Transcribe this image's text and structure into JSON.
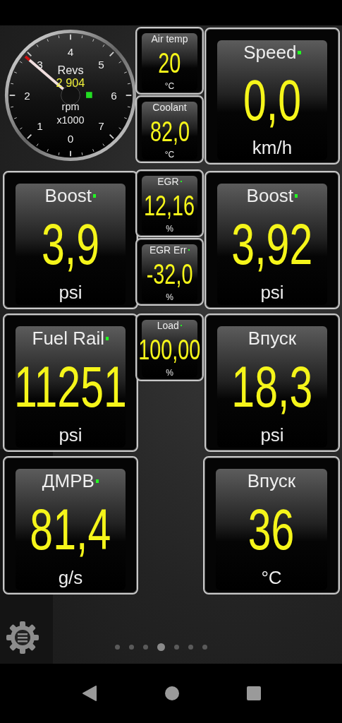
{
  "dial": {
    "label": "Revs",
    "value": "2 904",
    "unit": "rpm",
    "multiplier": "x1000",
    "scale": [
      "0",
      "1",
      "2",
      "3",
      "4",
      "5",
      "6",
      "7"
    ],
    "indicator": true
  },
  "gauges": [
    {
      "kind": "small",
      "label": "Air temp",
      "value": "20",
      "unit": "°C",
      "indicator": false
    },
    {
      "kind": "small",
      "label": "Coolant",
      "value": "82,0",
      "unit": "°C",
      "indicator": false
    },
    {
      "kind": "large",
      "label": "Speed",
      "value": "0,0",
      "unit": "km/h",
      "indicator": true
    },
    {
      "kind": "large",
      "label": "Boost",
      "value": "3,9",
      "unit": "psi",
      "indicator": true
    },
    {
      "kind": "small",
      "label": "EGR",
      "value": "12,16",
      "unit": "%",
      "indicator": true
    },
    {
      "kind": "small",
      "label": "EGR Err",
      "value": "-32,0",
      "unit": "%",
      "indicator": true
    },
    {
      "kind": "large",
      "label": "Boost",
      "value": "3,92",
      "unit": "psi",
      "indicator": true
    },
    {
      "kind": "large",
      "label": "Fuel Rail",
      "value": "11251",
      "unit": "psi",
      "indicator": true
    },
    {
      "kind": "small",
      "label": "Load",
      "value": "100,00",
      "unit": "%",
      "indicator": true
    },
    {
      "kind": "large",
      "label": "Впуск",
      "value": "18,3",
      "unit": "psi",
      "indicator": false
    },
    {
      "kind": "large",
      "label": "ДМРВ",
      "value": "81,4",
      "unit": "g/s",
      "indicator": true
    },
    {
      "kind": "large",
      "label": "Впуск",
      "value": "36",
      "unit": "°C",
      "indicator": false
    }
  ],
  "pages": [
    {
      "selected": false
    },
    {
      "selected": false
    },
    {
      "selected": false
    },
    {
      "selected": true
    },
    {
      "selected": false
    },
    {
      "selected": false
    },
    {
      "selected": false
    }
  ]
}
